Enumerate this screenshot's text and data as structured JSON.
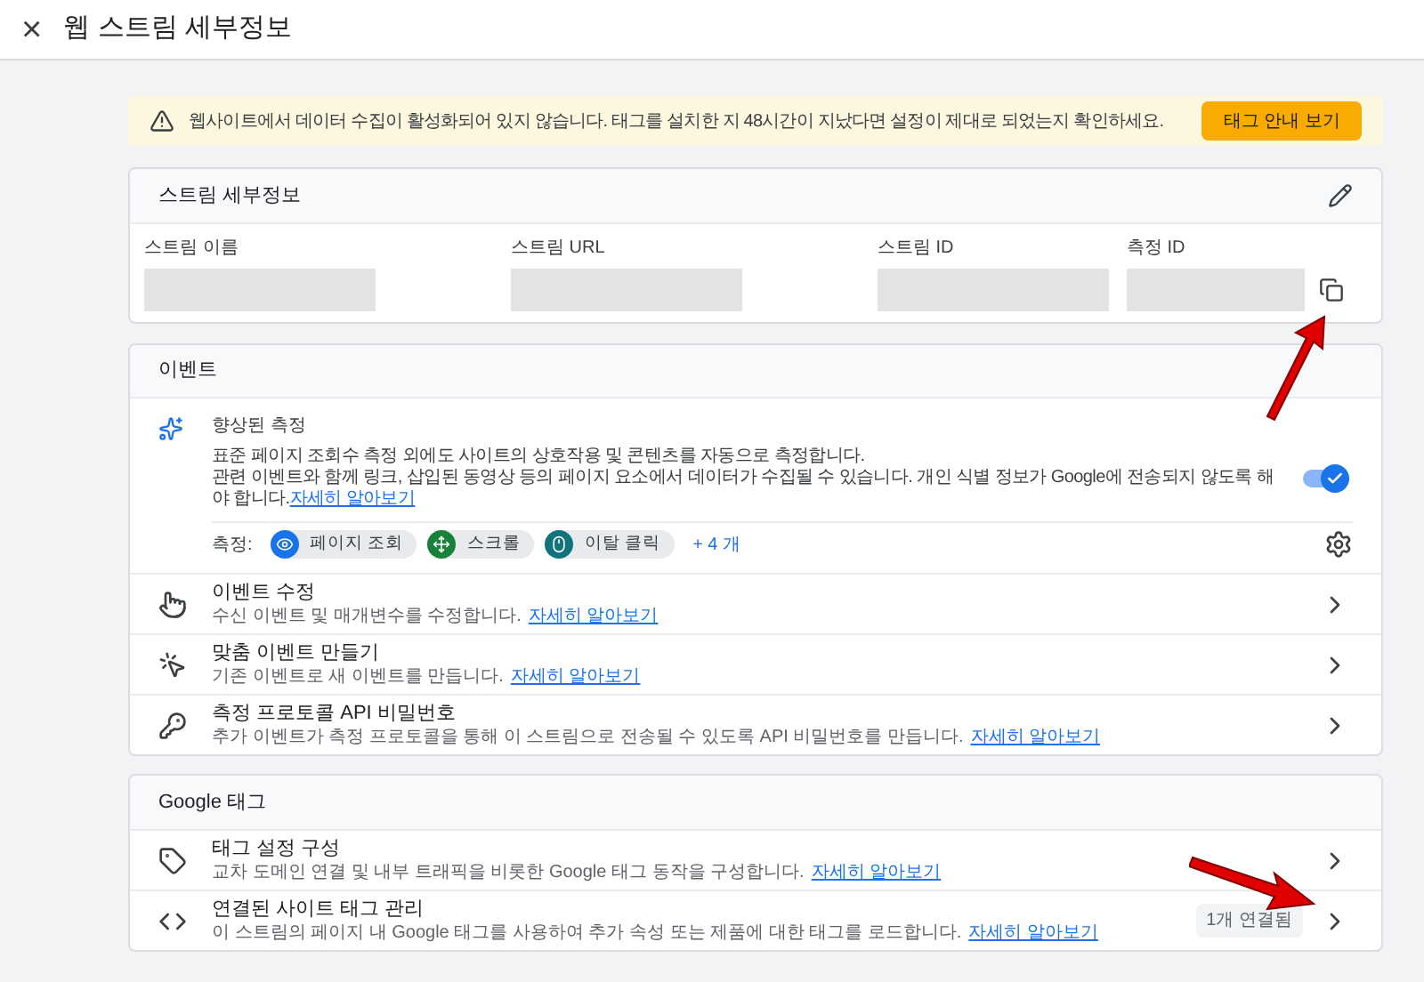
{
  "header": {
    "close": "×",
    "title": "웹 스트림 세부정보"
  },
  "banner": {
    "text": "웹사이트에서 데이터 수집이 활성화되어 있지 않습니다. 태그를 설치한 지 48시간이 지났다면 설정이 제대로 되었는지 확인하세요.",
    "button": "태그 안내 보기"
  },
  "stream_details": {
    "title": "스트림 세부정보",
    "fields": [
      {
        "label": "스트림 이름"
      },
      {
        "label": "스트림 URL"
      },
      {
        "label": "스트림 ID"
      },
      {
        "label": "측정 ID",
        "copy": true
      }
    ]
  },
  "events": {
    "title": "이벤트",
    "enhanced": {
      "title": "향상된 측정",
      "line_1": "표준 페이지 조회수 측정 외에도 사이트의 상호작용 및 콘텐츠를 자동으로 측정합니다.",
      "line_2": "관련 이벤트와 함께 링크, 삽입된 동영상 등의 페이지 요소에서 데이터가 수집될 수 있습니다. 개인 식별 정보가 Google에 전송되지 않도록 해야 합니다.",
      "link": "자세히 알아보기",
      "on": true,
      "measure_label": "측정:",
      "chips": [
        {
          "kind": "eye",
          "label": "페이지 조회",
          "color": "#1a73e8"
        },
        {
          "kind": "move",
          "label": "스크롤",
          "color": "#188038"
        },
        {
          "kind": "mouse",
          "label": "이탈 클릭",
          "color": "#12737d"
        }
      ],
      "more": "+ 4 개"
    },
    "rows": [
      {
        "kind": "touch",
        "title": "이벤트 수정",
        "desc": "수신 이벤트 및 매개변수를 수정합니다.",
        "link": "자세히 알아보기"
      },
      {
        "kind": "sparkle",
        "title": "맞춤 이벤트 만들기",
        "desc": "기존 이벤트로 새 이벤트를 만듭니다.",
        "link": "자세히 알아보기"
      },
      {
        "kind": "key",
        "title": "측정 프로토콜 API 비밀번호",
        "desc": "추가 이벤트가 측정 프로토콜을 통해 이 스트림으로 전송될 수 있도록 API 비밀번호를 만듭니다.",
        "link": "자세히 알아보기"
      }
    ]
  },
  "google_tag": {
    "title": "Google 태그",
    "rows": [
      {
        "kind": "tag",
        "title": "태그 설정 구성",
        "desc": "교차 도메인 연결 및 내부 트래픽을 비롯한 Google 태그 동작을 구성합니다.",
        "link": "자세히 알아보기"
      },
      {
        "kind": "code",
        "title": "연결된 사이트 태그 관리",
        "desc": "이 스트림의 페이지 내 Google 태그를 사용하여 추가 속성 또는 제품에 대한 태그를 로드합니다.",
        "link": "자세히 알아보기",
        "badge": "1개 연결됨"
      }
    ]
  }
}
